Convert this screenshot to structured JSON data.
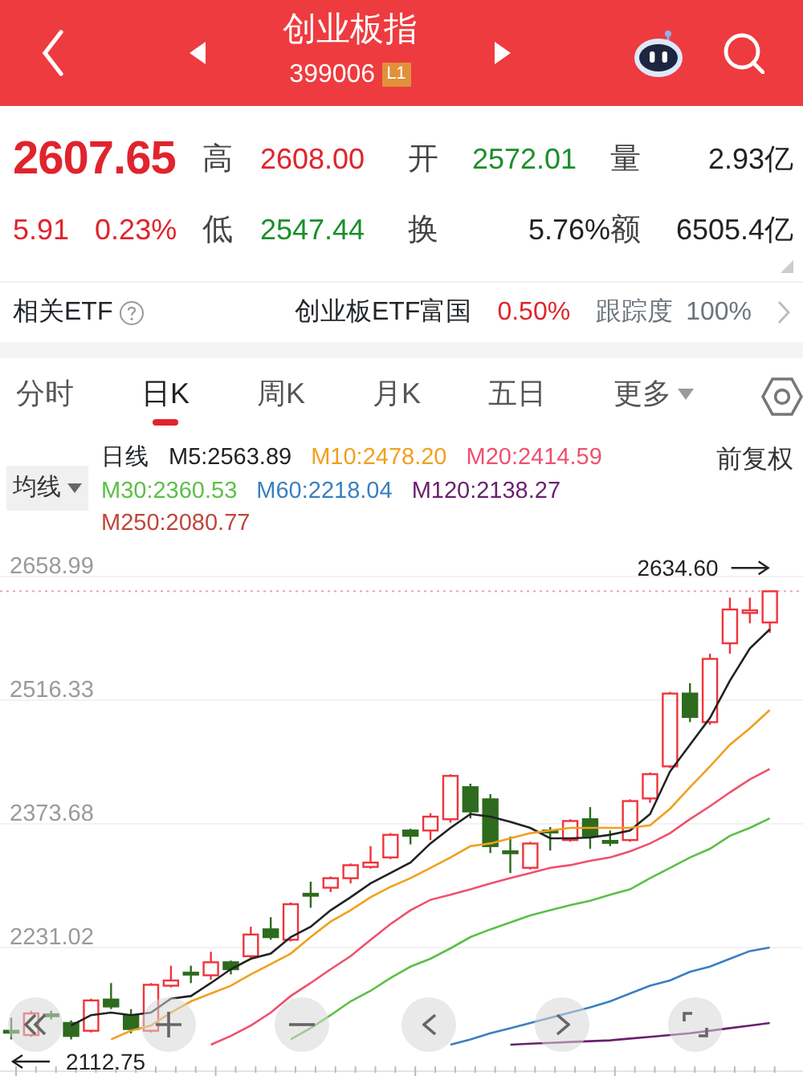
{
  "header": {
    "title": "创业板指",
    "code": "399006",
    "level_badge": "L1"
  },
  "quote": {
    "price": "2607.65",
    "change": "5.91",
    "change_pct": "0.23%",
    "color": "#e0242d",
    "fields": [
      {
        "label": "高",
        "value": "2608.00",
        "color": "#e0242d"
      },
      {
        "label": "开",
        "value": "2572.01",
        "color": "#1a8f2a"
      },
      {
        "label": "量",
        "value": "2.93亿",
        "color": "#222222"
      },
      {
        "label": "低",
        "value": "2547.44",
        "color": "#1a8f2a"
      },
      {
        "label": "换",
        "value": "5.76%",
        "color": "#222222"
      },
      {
        "label": "额",
        "value": "6505.4亿",
        "color": "#222222"
      }
    ]
  },
  "etf": {
    "label": "相关ETF",
    "name": "创业板ETF富国",
    "change": "0.50%",
    "tracking_label": "跟踪度",
    "tracking": "100%"
  },
  "tabs": [
    {
      "label": "分时",
      "selected": false,
      "dropdown": false
    },
    {
      "label": "日K",
      "selected": true,
      "dropdown": false
    },
    {
      "label": "周K",
      "selected": false,
      "dropdown": false
    },
    {
      "label": "月K",
      "selected": false,
      "dropdown": false
    },
    {
      "label": "五日",
      "selected": false,
      "dropdown": false
    },
    {
      "label": "更多",
      "selected": false,
      "dropdown": true
    }
  ],
  "ma_bar": {
    "selector": "均线",
    "period": "日线",
    "adjust": "前复权",
    "items": [
      {
        "label": "M5:2563.89",
        "color": "#222222"
      },
      {
        "label": "M10:2478.20",
        "color": "#f0a01e"
      },
      {
        "label": "M20:2414.59",
        "color": "#f0506e"
      },
      {
        "label": "M30:2360.53",
        "color": "#5cbf48"
      },
      {
        "label": "M60:2218.04",
        "color": "#3a7fc0"
      },
      {
        "label": "M120:2138.27",
        "color": "#6a1f6e"
      },
      {
        "label": "M250:2080.77",
        "color": "#c0453a"
      }
    ]
  },
  "chart_data": {
    "type": "candlestick",
    "grid": true,
    "ylim": [
      2088.36,
      2658.99
    ],
    "ref_lines": [
      {
        "axis": "y",
        "value": 2642
      }
    ],
    "yticks": [
      {
        "value": 2658.99,
        "label": "2658.99"
      },
      {
        "value": 2516.33,
        "label": "2516.33"
      },
      {
        "value": 2373.68,
        "label": "2373.68"
      },
      {
        "value": 2231.02,
        "label": "2231.02"
      }
    ],
    "ohlc": [
      [
        2135,
        2150,
        2125,
        2134
      ],
      [
        2130,
        2158,
        2128,
        2155
      ],
      [
        2154,
        2158,
        2148,
        2153
      ],
      [
        2144,
        2147,
        2125,
        2129
      ],
      [
        2135,
        2172,
        2133,
        2170
      ],
      [
        2171,
        2190,
        2160,
        2163
      ],
      [
        2153,
        2160,
        2132,
        2137
      ],
      [
        2135,
        2190,
        2133,
        2188
      ],
      [
        2187,
        2210,
        2185,
        2193
      ],
      [
        2202,
        2210,
        2190,
        2201
      ],
      [
        2199,
        2226,
        2194,
        2214
      ],
      [
        2214,
        2216,
        2200,
        2206
      ],
      [
        2221,
        2255,
        2219,
        2246
      ],
      [
        2252,
        2266,
        2240,
        2243
      ],
      [
        2240,
        2283,
        2238,
        2281
      ],
      [
        2293,
        2307,
        2277,
        2292
      ],
      [
        2300,
        2313,
        2295,
        2311
      ],
      [
        2311,
        2328,
        2305,
        2326
      ],
      [
        2324,
        2348,
        2322,
        2329
      ],
      [
        2335,
        2363,
        2333,
        2361
      ],
      [
        2366,
        2368,
        2350,
        2360
      ],
      [
        2366,
        2386,
        2355,
        2382
      ],
      [
        2379,
        2431,
        2375,
        2429
      ],
      [
        2416,
        2420,
        2380,
        2388
      ],
      [
        2402,
        2408,
        2340,
        2348
      ],
      [
        2342,
        2359,
        2317,
        2341
      ],
      [
        2323,
        2353,
        2321,
        2351
      ],
      [
        2366,
        2370,
        2343,
        2365
      ],
      [
        2355,
        2379,
        2353,
        2377
      ],
      [
        2379,
        2393,
        2345,
        2360
      ],
      [
        2354,
        2366,
        2348,
        2353
      ],
      [
        2355,
        2402,
        2353,
        2400
      ],
      [
        2403,
        2433,
        2398,
        2431
      ],
      [
        2440,
        2526,
        2438,
        2524
      ],
      [
        2524,
        2536,
        2491,
        2497
      ],
      [
        2491,
        2570,
        2488,
        2564
      ],
      [
        2582,
        2634.6,
        2570,
        2621
      ],
      [
        2617,
        2634.6,
        2605,
        2620
      ],
      [
        2606,
        2643,
        2594,
        2642
      ]
    ],
    "series": [
      {
        "type": "line",
        "color": "#222222",
        "values": [
          null,
          null,
          null,
          2141,
          2153,
          2156,
          2153,
          2156,
          2172,
          2175,
          2190,
          2206,
          2218,
          2224,
          2243,
          2255,
          2274,
          2289,
          2305,
          2317,
          2329,
          2351,
          2369,
          2385,
          2382,
          2376,
          2369,
          2357,
          2357,
          2358,
          2361,
          2366,
          2385,
          2434,
          2465,
          2496,
          2539,
          2576,
          2598
        ]
      },
      {
        "type": "line",
        "color": "#f0a01e",
        "values": [
          null,
          null,
          null,
          null,
          null,
          2125,
          2135,
          2141,
          2156,
          2169,
          2178,
          2187,
          2200,
          2212,
          2224,
          2243,
          2261,
          2274,
          2289,
          2301,
          2311,
          2323,
          2335,
          2348,
          2351,
          2357,
          2363,
          2366,
          2369,
          2369,
          2369,
          2369,
          2372,
          2391,
          2416,
          2440,
          2465,
          2484,
          2505
        ]
      },
      {
        "type": "line",
        "color": "#f0506e",
        "values": [
          null,
          null,
          null,
          null,
          null,
          null,
          null,
          null,
          null,
          null,
          2119,
          2129,
          2141,
          2156,
          2175,
          2190,
          2206,
          2221,
          2240,
          2258,
          2274,
          2286,
          2292,
          2298,
          2305,
          2311,
          2317,
          2323,
          2326,
          2331,
          2335,
          2342,
          2351,
          2363,
          2379,
          2394,
          2410,
          2425,
          2437
        ]
      },
      {
        "type": "line",
        "color": "#5cbf48",
        "values": [
          null,
          null,
          null,
          null,
          null,
          null,
          null,
          null,
          null,
          null,
          null,
          null,
          null,
          null,
          2125,
          2138,
          2153,
          2169,
          2181,
          2196,
          2209,
          2218,
          2230,
          2243,
          2252,
          2260,
          2268,
          2274,
          2280,
          2285,
          2292,
          2298,
          2311,
          2323,
          2335,
          2345,
          2360,
          2369,
          2380
        ]
      },
      {
        "type": "line",
        "color": "#3a7fc0",
        "values": [
          null,
          null,
          null,
          null,
          null,
          null,
          null,
          null,
          null,
          null,
          null,
          null,
          null,
          null,
          null,
          null,
          null,
          null,
          null,
          null,
          null,
          null,
          2119,
          2125,
          2132,
          2138,
          2144,
          2150,
          2156,
          2162,
          2169,
          2178,
          2187,
          2193,
          2203,
          2209,
          2218,
          2227,
          2231
        ]
      },
      {
        "type": "line",
        "color": "#6a1f6e",
        "values": [
          null,
          null,
          null,
          null,
          null,
          null,
          null,
          null,
          null,
          null,
          null,
          null,
          null,
          null,
          null,
          null,
          null,
          null,
          null,
          null,
          null,
          null,
          null,
          null,
          null,
          2119,
          2120,
          2121,
          2122,
          2123,
          2124,
          2126,
          2128,
          2130,
          2132,
          2135,
          2138,
          2141,
          2144
        ]
      }
    ],
    "annotations": [
      "2634.60",
      "2112.75"
    ]
  }
}
